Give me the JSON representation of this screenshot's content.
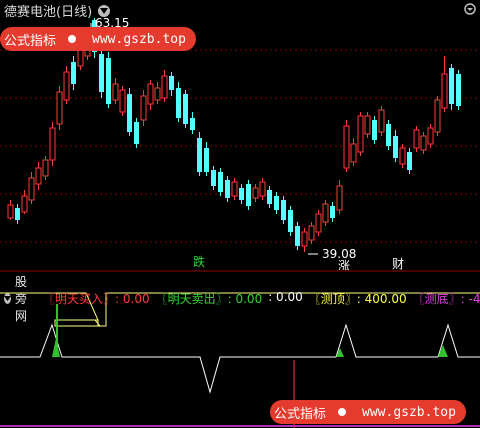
{
  "top": {
    "title": "德赛电池(日线)",
    "high_label": "63.15",
    "low_label": "39.08",
    "label_die": "跌",
    "label_zhang": "涨",
    "label_cai": "财"
  },
  "bottom": {
    "title": "股旁网",
    "params": [
      {
        "name": "〖明天买入〗",
        "value": ": 0.00",
        "name_color": "#ff3b3b",
        "value_color": "#ff3b3b"
      },
      {
        "name": "〖明天卖出〗",
        "value": ": 0.00",
        "name_color": "#35d435",
        "value_color": "#35d435"
      },
      {
        "name": "",
        "value": ": 0.00",
        "name_color": "#ffffff",
        "value_color": "#ffffff"
      },
      {
        "name": "〖测顶〗",
        "value": ": 400.00",
        "name_color": "#ffff40",
        "value_color": "#ffff40"
      },
      {
        "name": "〖测底〗",
        "value": ": -4",
        "name_color": "#e040e0",
        "value_color": "#e040e0"
      }
    ]
  },
  "watermark": {
    "brand": "公式指标",
    "url": "www.gszb.top"
  },
  "colors": {
    "up": "#ff3b3b",
    "down": "#54ffff",
    "grid": "#8b0000"
  }
}
